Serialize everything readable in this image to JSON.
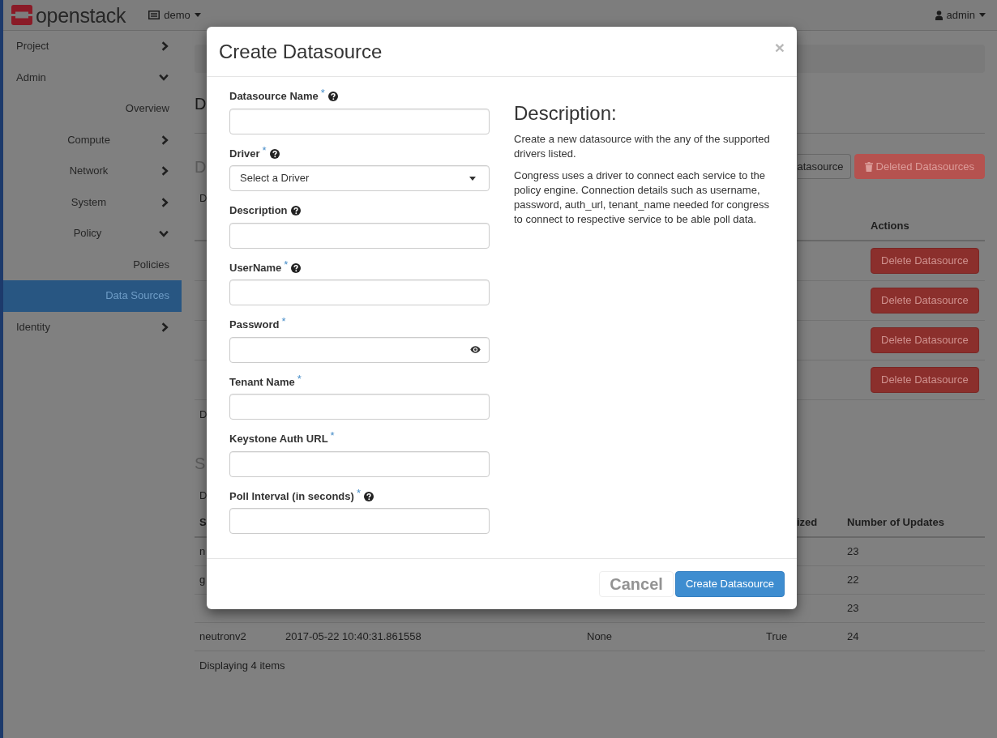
{
  "navbar": {
    "logo": "openstack",
    "project_menu": "demo",
    "user_menu": "admin"
  },
  "sidebar": {
    "items": [
      {
        "label": "Project",
        "kind": "group",
        "expanded": false,
        "selected": false
      },
      {
        "label": "Admin",
        "kind": "group",
        "expanded": true,
        "selected": false,
        "children": [
          {
            "label": "Overview",
            "kind": "link",
            "selected": false
          },
          {
            "label": "Compute",
            "kind": "group",
            "expanded": false,
            "selected": false
          },
          {
            "label": "Network",
            "kind": "group",
            "expanded": false,
            "selected": false
          },
          {
            "label": "System",
            "kind": "group",
            "expanded": false,
            "selected": false
          },
          {
            "label": "Policy",
            "kind": "group",
            "expanded": true,
            "selected": false,
            "children": [
              {
                "label": "Policies",
                "kind": "link",
                "selected": false
              },
              {
                "label": "Data Sources",
                "kind": "link",
                "selected": true
              }
            ]
          }
        ]
      },
      {
        "label": "Identity",
        "kind": "group",
        "expanded": false,
        "selected": false
      }
    ]
  },
  "page": {
    "title": "D",
    "datasources": {
      "heading": "D",
      "buttons": [
        {
          "label": "atasource",
          "kind": "default",
          "disabled": false
        },
        {
          "label": "Deleted Datasources",
          "kind": "danger",
          "disabled": true
        }
      ],
      "caption": "D",
      "table": {
        "columns": {
          "actions": "Actions"
        },
        "rows": [
          {
            "action": "Delete Datasource"
          },
          {
            "action": "Delete Datasource"
          },
          {
            "action": "Delete Datasource"
          },
          {
            "action": "Delete Datasource"
          }
        ]
      },
      "footer": "D"
    },
    "status": {
      "heading": "S",
      "caption": "D",
      "table": {
        "columns": {
          "column_1": "S",
          "column_4": "ized",
          "number_of_updates": "Number of Updates"
        },
        "rows": [
          {
            "column_1": "n",
            "number_of_updates": "23"
          },
          {
            "column_1": "g",
            "number_of_updates": "22"
          },
          {
            "number_of_updates": "23"
          },
          {
            "column_1": "neutronv2",
            "column_2": "2017-05-22 10:40:31.861558",
            "column_3": "None",
            "column_4": "True",
            "number_of_updates": "24"
          }
        ]
      },
      "footer": "Displaying 4 items"
    }
  },
  "modal": {
    "title": "Create Datasource",
    "close": "×",
    "fields": [
      {
        "label": "Datasource Name",
        "required_mark": "*",
        "help": true,
        "kind": "text"
      },
      {
        "label": "Driver",
        "required_mark": "*",
        "help": true,
        "kind": "select",
        "value": "Select a Driver"
      },
      {
        "label": "Description",
        "help": true,
        "kind": "text"
      },
      {
        "label": "UserName",
        "required_mark": "*",
        "help": true,
        "kind": "text"
      },
      {
        "label": "Password",
        "required_mark": "*",
        "help": false,
        "kind": "password"
      },
      {
        "label": "Tenant Name",
        "required_mark": "*",
        "help": false,
        "kind": "text"
      },
      {
        "label": "Keystone Auth URL",
        "required_mark": "*",
        "help": false,
        "kind": "text"
      },
      {
        "label": "Poll Interval (in seconds)",
        "required_mark": "*",
        "help": true,
        "kind": "text"
      }
    ],
    "description": {
      "heading": "Description:",
      "paragraphs": [
        "Create a new datasource with the any of the supported drivers listed.",
        "Congress uses a driver to connect each service to the policy engine. Connection details such as username, password, auth_url, tenant_name needed for congress to connect to respective service to be able poll data."
      ]
    },
    "buttons": [
      {
        "label": "Cancel",
        "kind": "cancel"
      },
      {
        "label": "Create Datasource",
        "kind": "primary"
      }
    ]
  }
}
